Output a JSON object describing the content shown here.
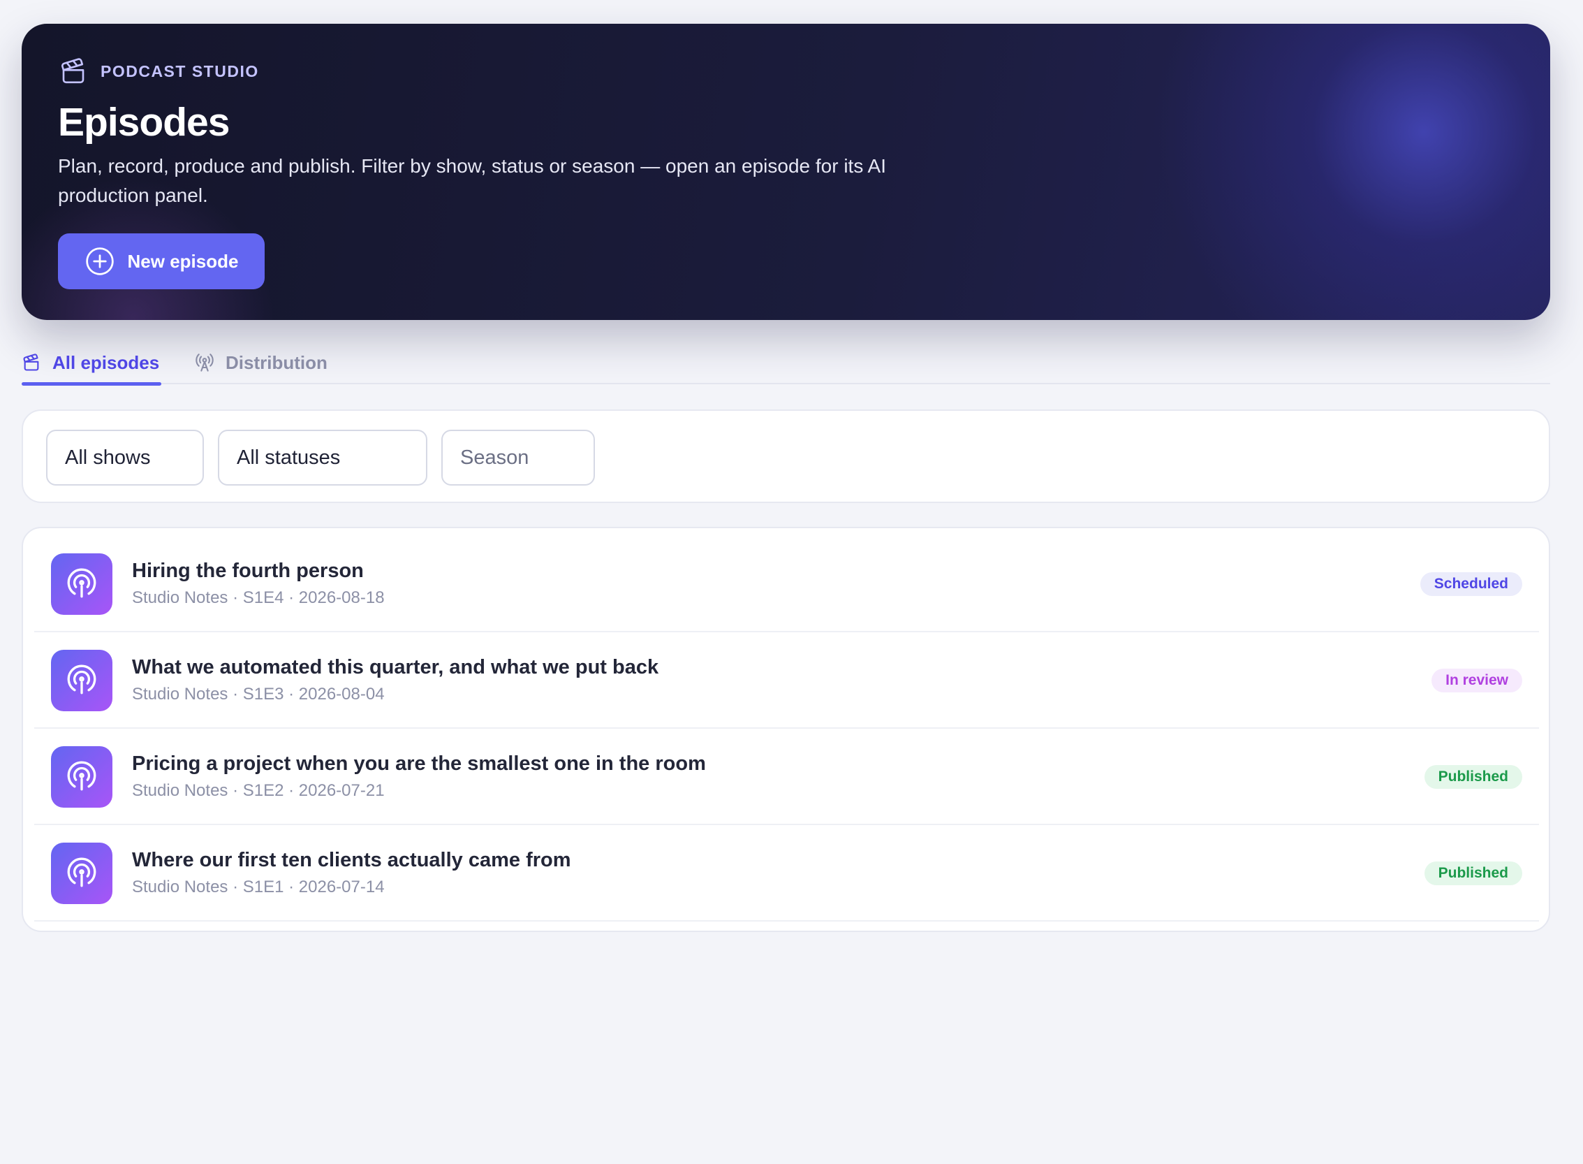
{
  "hero": {
    "eyebrow": "PODCAST STUDIO",
    "title": "Episodes",
    "subtitle": "Plan, record, produce and publish. Filter by show, status or season — open an episode for its AI production panel.",
    "new_button_label": "New episode",
    "eyebrow_icon": "clapperboard-icon",
    "new_button_icon": "plus-circle-icon"
  },
  "tabs": [
    {
      "label": "All episodes",
      "icon": "clapperboard-icon",
      "active": true
    },
    {
      "label": "Distribution",
      "icon": "broadcast-tower-icon",
      "active": false
    }
  ],
  "filters": {
    "show": "All shows",
    "status": "All statuses",
    "season_placeholder": "Season"
  },
  "episodes": [
    {
      "title": "Hiring the fourth person",
      "meta": "Studio Notes · S1E4 · 2026-08-18",
      "status": "Scheduled",
      "status_color": "#4f46e5",
      "icon": "podcast-icon"
    },
    {
      "title": "What we automated this quarter, and what we put back",
      "meta": "Studio Notes · S1E3 · 2026-08-04",
      "status": "In review",
      "status_color": "#b040e0",
      "icon": "podcast-icon"
    },
    {
      "title": "Pricing a project when you are the smallest one in the room",
      "meta": "Studio Notes · S1E2 · 2026-07-21",
      "status": "Published",
      "status_color": "#1b9a4a",
      "icon": "podcast-icon"
    },
    {
      "title": "Where our first ten clients actually came from",
      "meta": "Studio Notes · S1E1 · 2026-07-14",
      "status": "Published",
      "status_color": "#1b9a4a",
      "icon": "podcast-icon"
    }
  ],
  "colors": {
    "accent": "#6366f1",
    "hero_bg": "#1b1c3c",
    "page_bg": "#f3f4f9"
  }
}
